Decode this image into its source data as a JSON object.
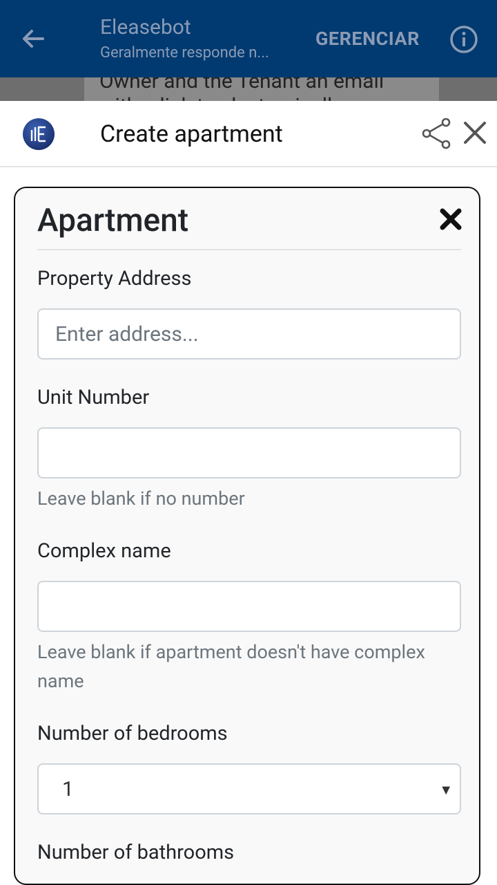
{
  "appbar": {
    "title": "Eleasebot",
    "subtitle": "Geralmente responde n...",
    "manage_label": "GERENCIAR"
  },
  "background_chat": {
    "line1": "Owner and the Tenant an email",
    "line2": "with a link to electronically"
  },
  "sheet": {
    "title": "Create apartment"
  },
  "form": {
    "title": "Apartment",
    "property_address": {
      "label": "Property Address",
      "placeholder": "Enter address...",
      "value": ""
    },
    "unit_number": {
      "label": "Unit Number",
      "value": "",
      "help": "Leave blank if no number"
    },
    "complex_name": {
      "label": "Complex name",
      "value": "",
      "help": "Leave blank if apartment doesn't have complex name"
    },
    "bedrooms": {
      "label": "Number of bedrooms",
      "selected": "1"
    },
    "bathrooms": {
      "label": "Number of bathrooms"
    }
  },
  "colors": {
    "appbar": "#003a70",
    "card_border": "#111111",
    "input_border": "#ced4da",
    "help_text": "#6c757d"
  }
}
